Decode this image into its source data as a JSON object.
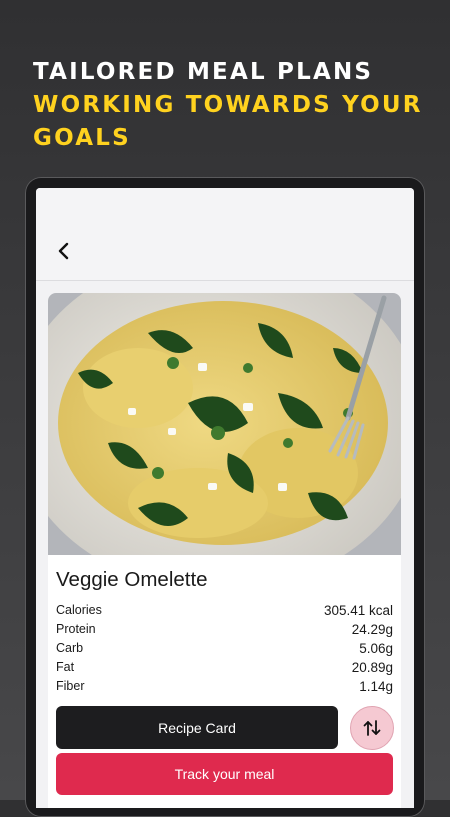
{
  "headline": {
    "line1": "TAILORED MEAL PLANS",
    "line2": "WORKING TOWARDS YOUR GOALS"
  },
  "colors": {
    "accent_yellow": "#ffd21f",
    "primary_button": "#1d1d1f",
    "track_button": "#df2a4e",
    "swap_button_bg": "#f5c9d2"
  },
  "appbar": {
    "back_icon": "chevron-left-icon"
  },
  "meal": {
    "name": "Veggie Omelette",
    "photo_icon": "food-photo",
    "nutrition": [
      {
        "label": "Calories",
        "value": "305.41 kcal"
      },
      {
        "label": "Protein",
        "value": "24.29g"
      },
      {
        "label": "Carb",
        "value": "5.06g"
      },
      {
        "label": "Fat",
        "value": "20.89g"
      },
      {
        "label": "Fiber",
        "value": "1.14g"
      }
    ]
  },
  "actions": {
    "recipe_card": "Recipe Card",
    "swap_icon": "swap-arrows-icon",
    "track_meal": "Track your meal"
  }
}
